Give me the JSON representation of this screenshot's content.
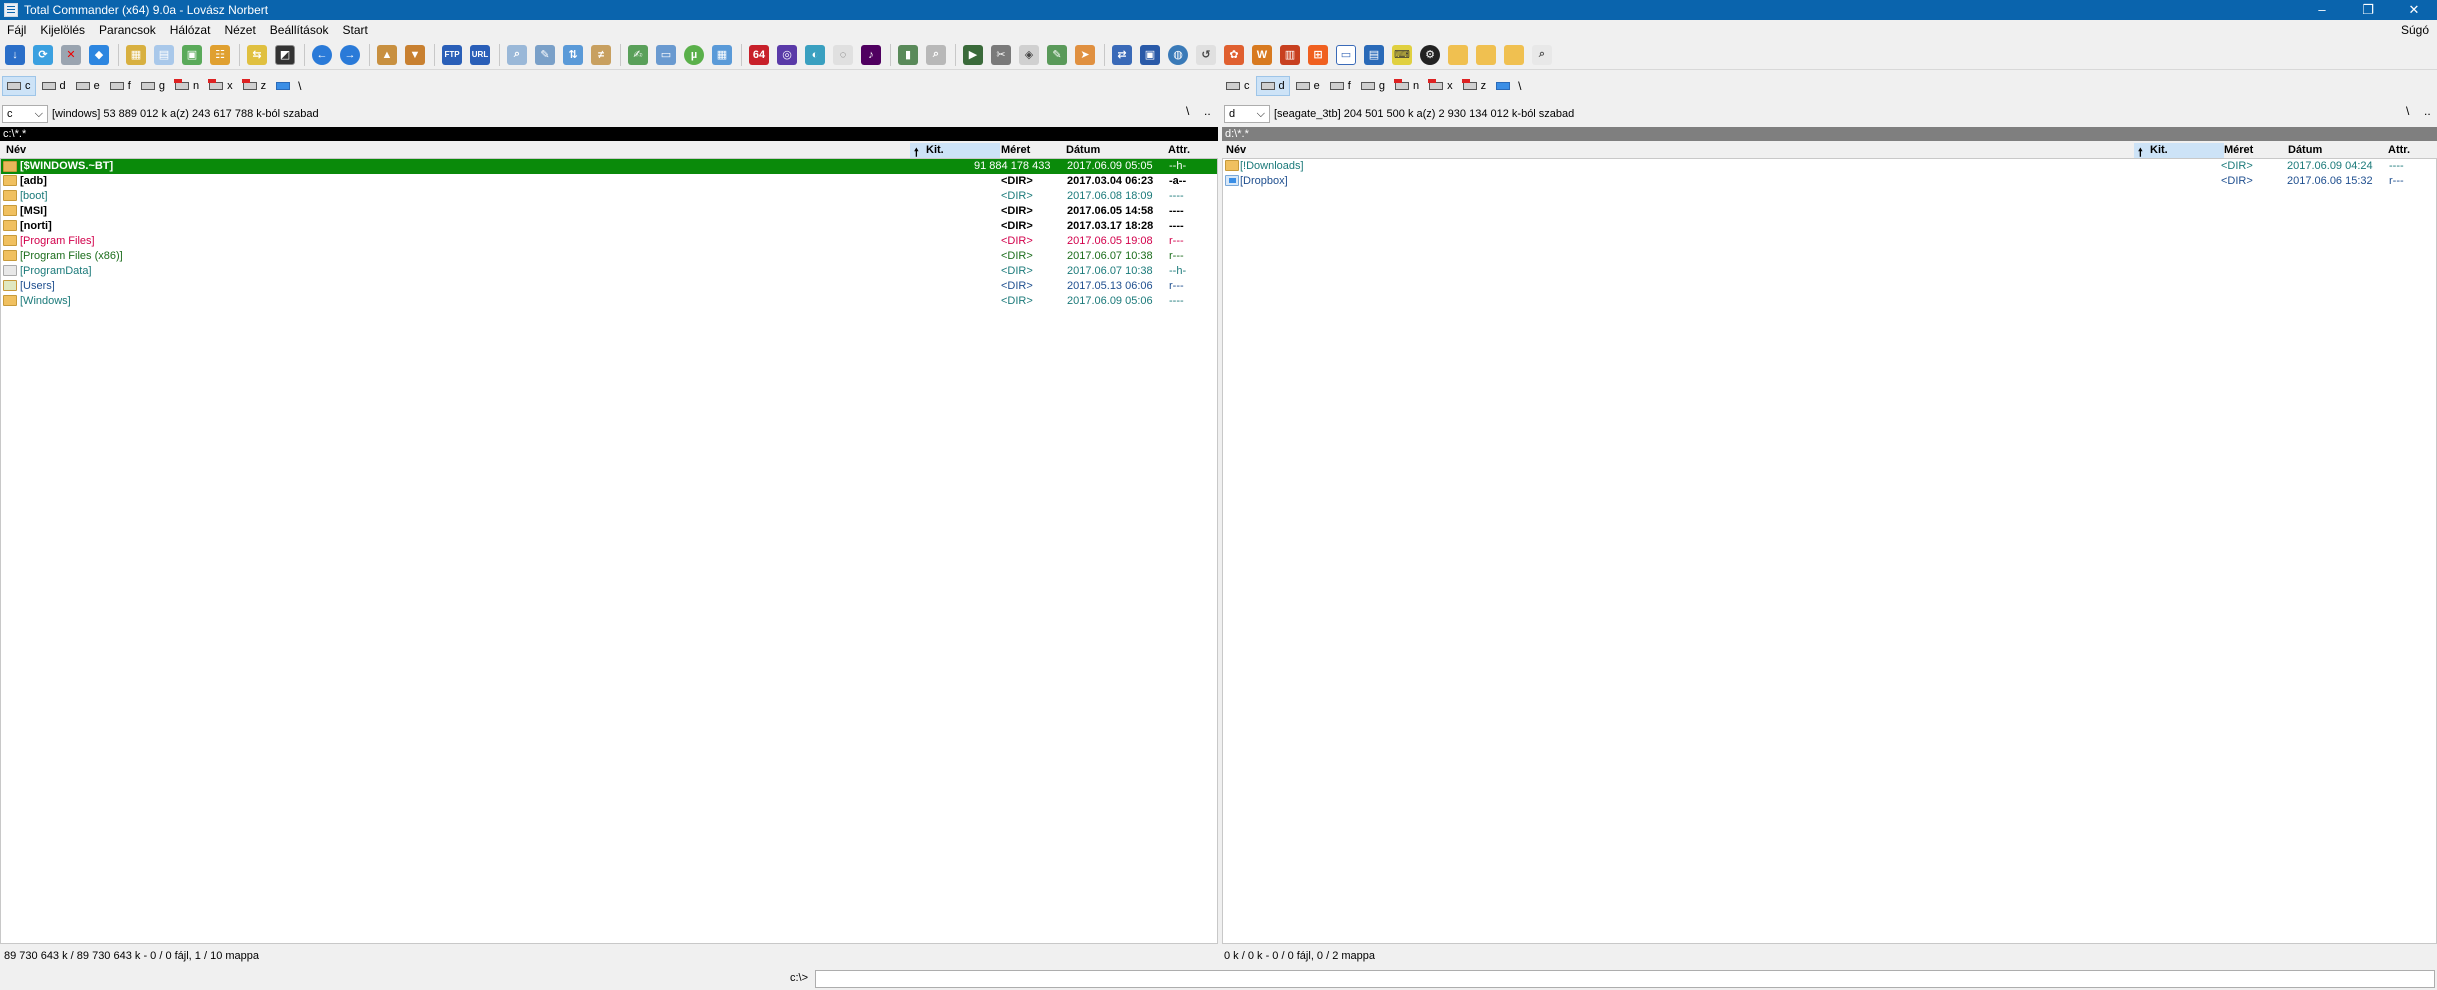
{
  "window": {
    "title": "Total Commander (x64) 9.0a - Lovász Norbert",
    "min": "–",
    "max": "❐",
    "close": "✕"
  },
  "menu": {
    "items": [
      "Fájl",
      "Kijelölés",
      "Parancsok",
      "Hálózat",
      "Nézet",
      "Beállítások",
      "Start"
    ],
    "help": "Súgó"
  },
  "toolbar": {
    "badge_64": "64"
  },
  "drives": [
    "c",
    "d",
    "e",
    "f",
    "g",
    "n",
    "x",
    "z"
  ],
  "drive_up": "\\",
  "left": {
    "drive": "c",
    "info": "[windows]  53 889 012 k a(z) 243 617 788 k-ból szabad",
    "nav_root": "\\",
    "nav_up": "..",
    "path": "c:\\*.*",
    "cols": {
      "name": "Név",
      "ext": "Kit.",
      "size": "Méret",
      "date": "Dátum",
      "attr": "Attr."
    },
    "files": [
      {
        "name": "[$WINDOWS.~BT]",
        "size": "91 884 178 433",
        "date": "2017.06.09 05:05",
        "attr": "--h-",
        "color": "white",
        "cursor": true
      },
      {
        "name": "[adb]",
        "size": "<DIR>",
        "date": "2017.03.04 06:23",
        "attr": "-a--",
        "color": "black"
      },
      {
        "name": "[boot]",
        "size": "<DIR>",
        "date": "2017.06.08 18:09",
        "attr": "----",
        "color": "teal"
      },
      {
        "name": "[MSI]",
        "size": "<DIR>",
        "date": "2017.06.05 14:58",
        "attr": "----",
        "color": "black"
      },
      {
        "name": "[norti]",
        "size": "<DIR>",
        "date": "2017.03.17 18:28",
        "attr": "----",
        "color": "black"
      },
      {
        "name": "[Program Files]",
        "size": "<DIR>",
        "date": "2017.06.05 19:08",
        "attr": "r---",
        "color": "red"
      },
      {
        "name": "[Program Files (x86)]",
        "size": "<DIR>",
        "date": "2017.06.07 10:38",
        "attr": "r---",
        "color": "green"
      },
      {
        "name": "[ProgramData]",
        "size": "<DIR>",
        "date": "2017.06.07 10:38",
        "attr": "--h-",
        "color": "teal"
      },
      {
        "name": "[Users]",
        "size": "<DIR>",
        "date": "2017.05.13 06:06",
        "attr": "r---",
        "color": "navy"
      },
      {
        "name": "[Windows]",
        "size": "<DIR>",
        "date": "2017.06.09 05:06",
        "attr": "----",
        "color": "teal"
      }
    ],
    "status": "89 730 643 k / 89 730 643 k - 0 / 0 fájl, 1 / 10 mappa"
  },
  "right": {
    "drive": "d",
    "info": "[seagate_3tb]  204 501 500 k a(z) 2 930 134 012 k-ból szabad",
    "nav_root": "\\",
    "nav_up": "..",
    "path": "d:\\*.*",
    "cols": {
      "name": "Név",
      "ext": "Kit.",
      "size": "Méret",
      "date": "Dátum",
      "attr": "Attr."
    },
    "files": [
      {
        "name": "[!Downloads]",
        "size": "<DIR>",
        "date": "2017.06.09 04:24",
        "attr": "----",
        "color": "teal"
      },
      {
        "name": "[Dropbox]",
        "size": "<DIR>",
        "date": "2017.06.06 15:32",
        "attr": "r---",
        "color": "navy"
      }
    ],
    "status": "0 k / 0 k - 0 / 0 fájl, 0 / 2 mappa"
  },
  "cmdline": {
    "prompt": "c:\\>",
    "value": ""
  }
}
